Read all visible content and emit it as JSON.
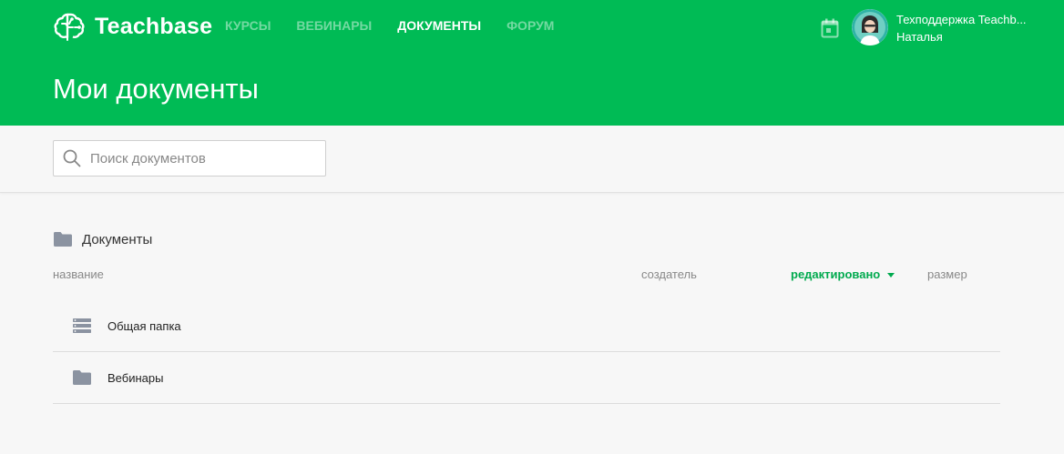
{
  "header": {
    "brand": "Teachbase",
    "nav": [
      {
        "label": "КУРСЫ",
        "active": false
      },
      {
        "label": "ВЕБИНАРЫ",
        "active": false
      },
      {
        "label": "ДОКУМЕНТЫ",
        "active": true
      },
      {
        "label": "ФОРУМ",
        "active": false
      }
    ],
    "user": {
      "line1": "Техподдержка Teachb...",
      "line2": "Наталья"
    },
    "icons": {
      "logo": "brain-logo-icon",
      "calendar": "calendar-icon",
      "avatar": "user-avatar"
    }
  },
  "page": {
    "title": "Мои документы"
  },
  "search": {
    "placeholder": "Поиск документов",
    "value": "",
    "icon": "search-icon"
  },
  "breadcrumb": {
    "label": "Документы",
    "icon": "folder-icon"
  },
  "table": {
    "columns": [
      {
        "key": "name",
        "label": "название"
      },
      {
        "key": "creator",
        "label": "создатель"
      },
      {
        "key": "edited",
        "label": "редактировано",
        "sorted": true,
        "direction": "desc"
      },
      {
        "key": "size",
        "label": "размер"
      }
    ],
    "rows": [
      {
        "name": "Общая папка",
        "icon": "shared-folder-icon"
      },
      {
        "name": "Вебинары",
        "icon": "folder-icon"
      }
    ]
  },
  "colors": {
    "brand": "#00bb55",
    "accent": "#00aa4e",
    "icon_gray": "#8b93a1"
  }
}
